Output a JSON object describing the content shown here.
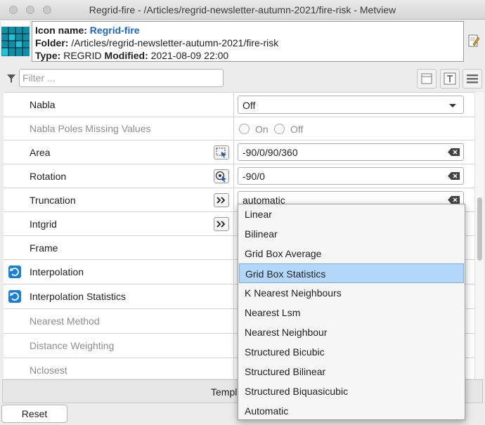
{
  "window": {
    "title": "Regrid-fire - /Articles/regrid-newsletter-autumn-2021/fire-risk - Metview"
  },
  "header": {
    "icon_name_label": "Icon name:",
    "icon_name": "Regrid-fire",
    "folder_label": "Folder:",
    "folder": "/Articles/regrid-newsletter-autumn-2021/fire-risk",
    "type_label": "Type:",
    "type": "REGRID",
    "modified_label": "Modified:",
    "modified": "2021-08-09 22:00"
  },
  "filter": {
    "placeholder": "Filter ..."
  },
  "rows": [
    {
      "label": "Nabla",
      "value": "Off"
    },
    {
      "label": "Nabla Poles Missing Values",
      "option_on": "On",
      "option_off": "Off"
    },
    {
      "label": "Area",
      "value": "-90/0/90/360"
    },
    {
      "label": "Rotation",
      "value": "-90/0"
    },
    {
      "label": "Truncation",
      "value": "automatic"
    },
    {
      "label": "Intgrid"
    },
    {
      "label": "Frame"
    },
    {
      "label": "Interpolation"
    },
    {
      "label": "Interpolation Statistics"
    },
    {
      "label": "Nearest Method"
    },
    {
      "label": "Distance Weighting"
    },
    {
      "label": "Nclosest"
    }
  ],
  "dropdown": {
    "selected": "Grid Box Statistics",
    "items": [
      "Linear",
      "Bilinear",
      "Grid Box Average",
      "Grid Box Statistics",
      "K Nearest Neighbours",
      "Nearest Lsm",
      "Nearest Neighbour",
      "Structured Bicubic",
      "Structured Bilinear",
      "Structured Biquasicubic",
      "Automatic"
    ]
  },
  "bottom": {
    "template_label": "Templ",
    "reset_label": "Reset"
  },
  "colors": {
    "accent": "#1a66c7",
    "selection": "#b3d7fb",
    "reset_icon": "#1a7fd3"
  }
}
